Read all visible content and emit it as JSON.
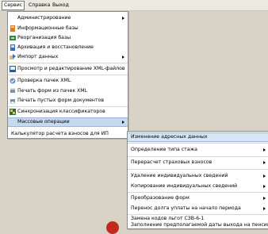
{
  "menubar": {
    "items": [
      "Сервис",
      "Справка",
      "Выход"
    ]
  },
  "service_menu": {
    "items": [
      {
        "label": "Администрирование",
        "icon": "none",
        "sub": true
      },
      {
        "label": "Информационные базы",
        "icon": "db-icon"
      },
      {
        "label": "Реорганизация базы",
        "icon": "db-reorg-icon"
      },
      {
        "label": "Архивация и восстановление",
        "icon": "archive-icon"
      },
      {
        "label": "Импорт данных",
        "icon": "import-icon",
        "sub": true
      },
      {
        "label": "Просмотр и редактирование XML-файлов",
        "icon": "xml-icon"
      },
      {
        "label": "Проверка пачек XML",
        "icon": "check-icon"
      },
      {
        "label": "Печать форм из пачек XML",
        "icon": "print-icon"
      },
      {
        "label": "Печать пустых форм документов",
        "icon": "print-blank-icon"
      },
      {
        "label": "Синхронизация классификаторов",
        "icon": "sync-icon"
      },
      {
        "label": "Массовые операции",
        "icon": "none",
        "sub": true
      },
      {
        "label": "Калькулятор расчета взносов для ИП",
        "icon": "none"
      }
    ]
  },
  "mass_ops_menu": {
    "items": [
      {
        "label": "Изменение адресных данных",
        "sub": false
      },
      {
        "label": "Определение типа стажа",
        "sub": true
      },
      {
        "label": "Перерасчет страховых взносов",
        "sub": true
      },
      {
        "label": "Удаление индивидуальных сведений",
        "sub": true
      },
      {
        "label": "Копирование индивидуальных сведений",
        "sub": true
      },
      {
        "label": "Преобразование форм",
        "sub": true
      },
      {
        "label": "Перенос долга уплаты на начало периода",
        "sub": true
      },
      {
        "label": "Замена кодов льгот СЗВ-6-1",
        "sub": false
      },
      {
        "label": "Заполнение предполагаемой даты выхода на пенсию",
        "sub": false
      }
    ]
  },
  "colors": {
    "highlight": "#c6d9ef",
    "background": "#d8d3c6"
  }
}
